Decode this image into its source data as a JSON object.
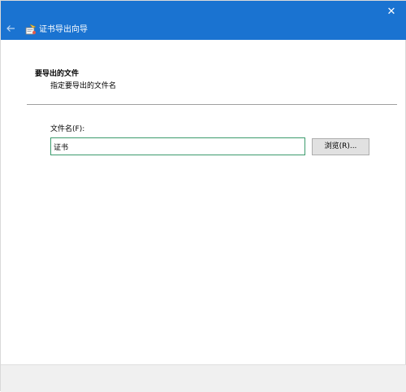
{
  "window": {
    "title_bar_color": "#1a73d1",
    "close_glyph": "✕"
  },
  "header": {
    "back_icon": "back-arrow-icon",
    "wizard_icon": "certificate-wizard-icon",
    "title": "证书导出向导"
  },
  "section": {
    "heading": "要导出的文件",
    "description": "指定要导出的文件名"
  },
  "form": {
    "file_name_label": "文件名(F):",
    "file_name_value": "证书",
    "input_border_color": "#3c9b6d",
    "browse_label": "浏览(R)..."
  }
}
